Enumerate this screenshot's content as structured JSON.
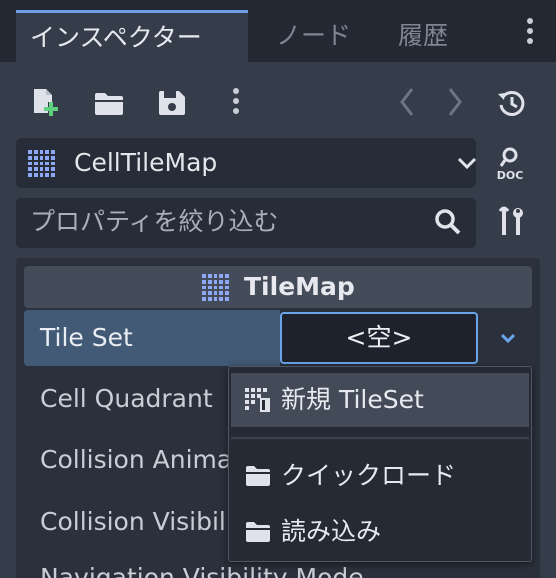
{
  "tabs": [
    {
      "label": "インスペクター",
      "active": true
    },
    {
      "label": "ノード",
      "active": false
    },
    {
      "label": "履歴",
      "active": false
    }
  ],
  "toolbar": {
    "icons": [
      "new-resource-icon",
      "open-folder-icon",
      "save-icon",
      "more-menu-icon",
      "history-back-icon",
      "history-forward-icon",
      "recent-history-icon"
    ]
  },
  "object": {
    "name": "CellTileMap"
  },
  "filter": {
    "placeholder": "プロパティを絞り込む"
  },
  "category": {
    "title": "TileMap"
  },
  "properties": {
    "tile_set": {
      "label": "Tile Set",
      "value": "<空>"
    },
    "rows": [
      "Cell Quadrant",
      "Collision Animatable",
      "Collision Visibility Mode",
      "Navigation Visibility Mode"
    ]
  },
  "menu": {
    "items": [
      {
        "label": "新規 TileSet"
      },
      {
        "label": "クイックロード"
      },
      {
        "label": "読み込み"
      }
    ]
  },
  "colors": {
    "accent": "#6f9fe2",
    "panel": "#353d4a",
    "selected_row": "#425a76",
    "tilemap_icon": "#8ea8f6"
  }
}
